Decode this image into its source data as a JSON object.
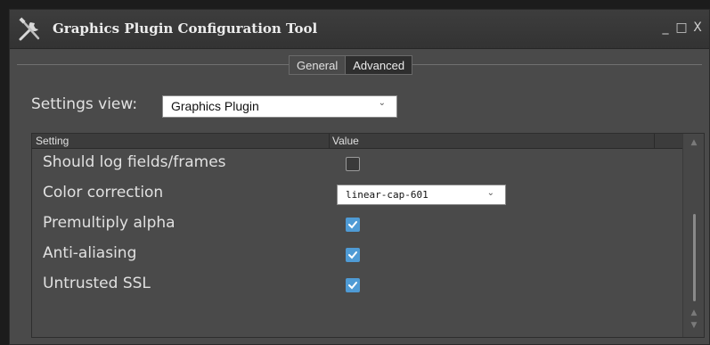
{
  "window": {
    "title": "Graphics Plugin Configuration Tool",
    "app_icon": "tools-icon",
    "controls": {
      "minimize": "_",
      "maximize": "□",
      "close": "X"
    }
  },
  "tabs": [
    {
      "label": "General",
      "selected": false
    },
    {
      "label": "Advanced",
      "selected": true
    }
  ],
  "settings_view": {
    "label": "Settings view:",
    "value": "Graphics Plugin"
  },
  "grid": {
    "headers": {
      "setting": "Setting",
      "value": "Value"
    },
    "rows": [
      {
        "label": "Should log fields/frames",
        "type": "checkbox",
        "checked": false
      },
      {
        "label": "Color correction",
        "type": "select",
        "value": "linear-cap-601"
      },
      {
        "label": "Premultiply alpha",
        "type": "checkbox",
        "checked": true
      },
      {
        "label": "Anti-aliasing",
        "type": "checkbox",
        "checked": true
      },
      {
        "label": "Untrusted SSL",
        "type": "checkbox",
        "checked": true
      }
    ]
  },
  "colors": {
    "accent_checkbox": "#4f9bd5",
    "panel_bg": "#4a4a4a",
    "titlebar_bg": "#353535"
  }
}
